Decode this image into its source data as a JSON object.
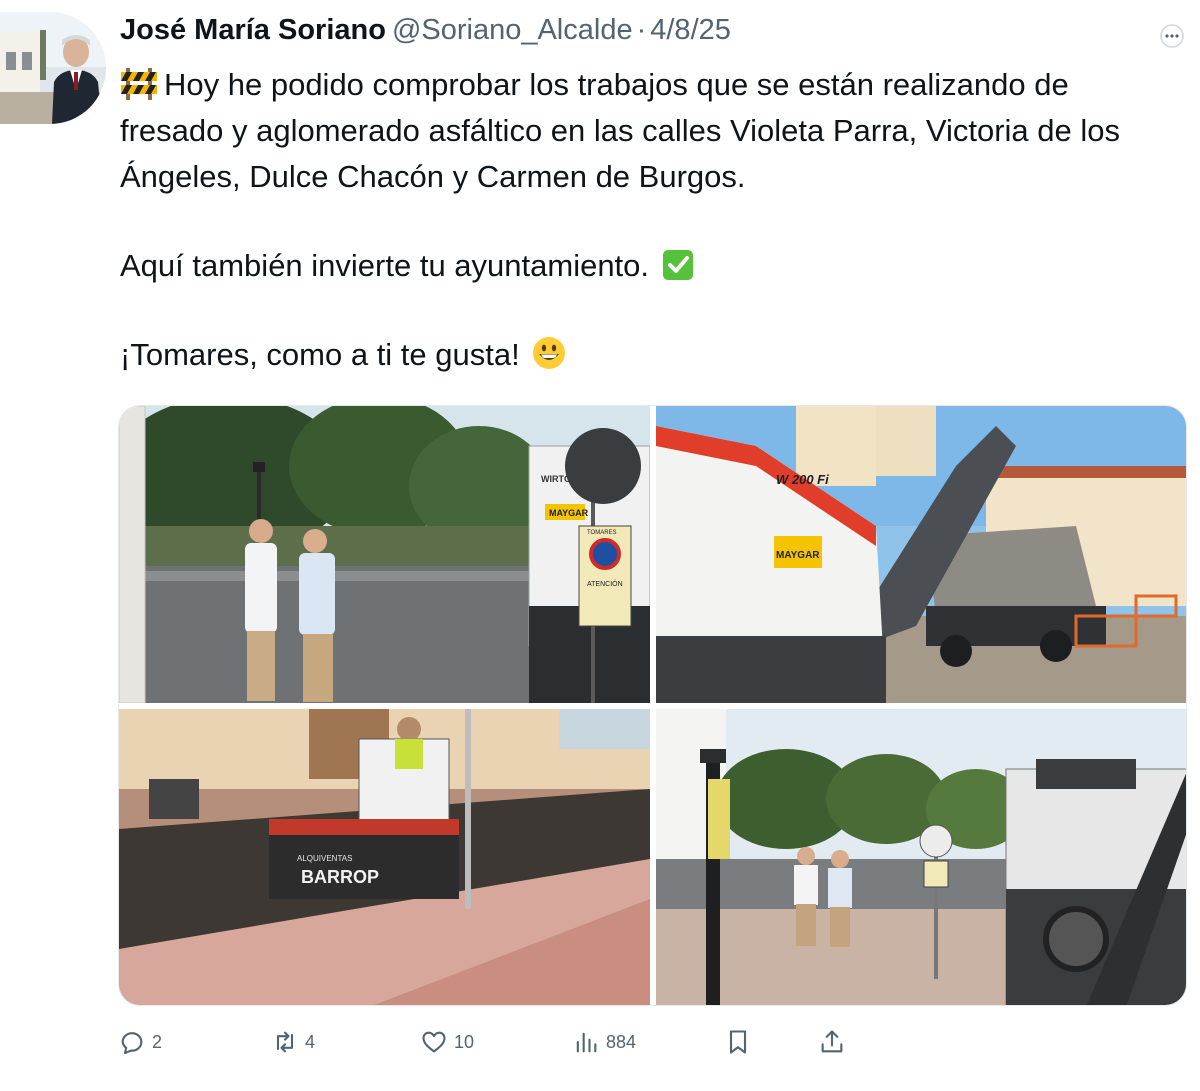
{
  "tweet": {
    "author_name": "José María Soriano",
    "handle": "@Soriano_Alcalde",
    "separator": "·",
    "date": "4/8/25",
    "lines": [
      "Hoy he podido comprobar los trabajos que se están realizando de",
      "fresado y aglomerado asfáltico en las calles Violeta Parra, Victoria de los",
      "Ángeles, Dulce Chacón y Carmen de Burgos.",
      "Aquí también invierte tu ayuntamiento.",
      "¡Tomares, como a ti te gusta!"
    ],
    "emojis": [
      "construction",
      "check-mark-button",
      "grinning-face"
    ]
  },
  "media": {
    "photo_1": {
      "labels": [
        "WIRTGEN",
        "MAYGAR",
        "ATENCIÓN",
        "TOMARES"
      ]
    },
    "photo_2": {
      "labels": [
        "W 200 Fi",
        "MAYGAR"
      ]
    },
    "photo_3": {
      "labels": [
        "ALQUIVENTAS",
        "BARROP"
      ]
    },
    "photo_4": {
      "labels": []
    }
  },
  "actions": {
    "replies": "2",
    "reposts": "4",
    "likes": "10",
    "views": "884"
  },
  "colors": {
    "text": "#0f1419",
    "secondary": "#536471",
    "check_green": "#56c23b"
  }
}
